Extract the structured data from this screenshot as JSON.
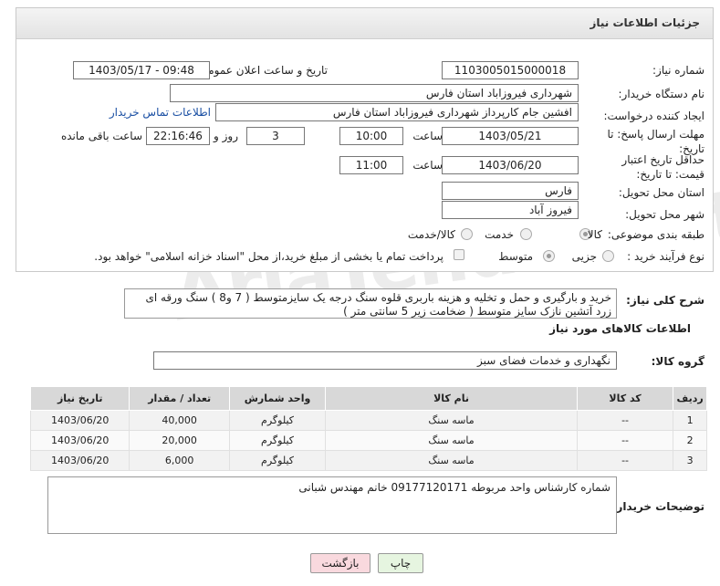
{
  "header": {
    "title": "جزئیات اطلاعات نیاز"
  },
  "form": {
    "need_number_label": "شماره نیاز:",
    "need_number": "1103005015000018",
    "announce_label": "تاریخ و ساعت اعلان عمومی:",
    "announce_value": "1403/05/17 - 09:48",
    "buyer_org_label": "نام دستگاه خریدار:",
    "buyer_org": "شهرداری فیروزاباد استان فارس",
    "requester_label": "ایجاد کننده درخواست:",
    "requester": "افشین جام کارپرداز شهرداری فیروزاباد استان فارس",
    "contact_link": "اطلاعات تماس خریدار",
    "deadline_label": "مهلت ارسال پاسخ: تا تاریخ:",
    "deadline_date": "1403/05/21",
    "time_label": "ساعت",
    "deadline_time": "10:00",
    "days_value": "3",
    "days_label": "روز و",
    "remaining_value": "22:16:46",
    "remaining_label": "ساعت باقی مانده",
    "validity_label": "حداقل تاریخ اعتبار قیمت: تا تاریخ:",
    "validity_date": "1403/06/20",
    "validity_time": "11:00",
    "province_label": "استان محل تحویل:",
    "province": "فارس",
    "city_label": "شهر محل تحویل:",
    "city": "فیروز آباد",
    "category_label": "طبقه بندی موضوعی:",
    "category_options": [
      "کالا",
      "خدمت",
      "کالا/خدمت"
    ],
    "purchase_type_label": "نوع فرآیند خرید :",
    "purchase_options": [
      "جزیی",
      "متوسط"
    ],
    "payment_note": "پرداخت تمام یا بخشی از مبلغ خرید،از محل \"اسناد خزانه اسلامی\" خواهد بود."
  },
  "description": {
    "label": "شرح کلی نیاز:",
    "text": "خرید و بارگیری و حمل و تخلیه و هزینه باربری قلوه سنگ درجه یک سایزمتوسط ( 7 و8 ) سنگ ورقه ای زرد آتشین نازک سایز متوسط ( ضخامت زیر 5 سانتی متر )"
  },
  "goods_section": {
    "title": "اطلاعات کالاهای مورد نیاز",
    "group_label": "گروه کالا:",
    "group_value": "نگهداری و خدمات فضای سبز"
  },
  "table": {
    "headers": [
      "ردیف",
      "کد کالا",
      "نام کالا",
      "واحد شمارش",
      "تعداد / مقدار",
      "تاریخ نیاز"
    ],
    "rows": [
      [
        "1",
        "--",
        "ماسه سنگ",
        "کیلوگرم",
        "40,000",
        "1403/06/20"
      ],
      [
        "2",
        "--",
        "ماسه سنگ",
        "کیلوگرم",
        "20,000",
        "1403/06/20"
      ],
      [
        "3",
        "--",
        "ماسه سنگ",
        "کیلوگرم",
        "6,000",
        "1403/06/20"
      ]
    ]
  },
  "buyer_notes": {
    "label": "توضیحات خریدار:",
    "text": "شماره کارشناس واحد مربوطه 09177120171 خانم مهندس شبانی"
  },
  "buttons": {
    "print": "چاپ",
    "back": "بازگشت"
  },
  "watermark": "AriaTender.net",
  "colors": {
    "link": "#1a4fa3",
    "back_button_bg": "#f9d9de",
    "print_button_bg": "#e6f5e0"
  }
}
